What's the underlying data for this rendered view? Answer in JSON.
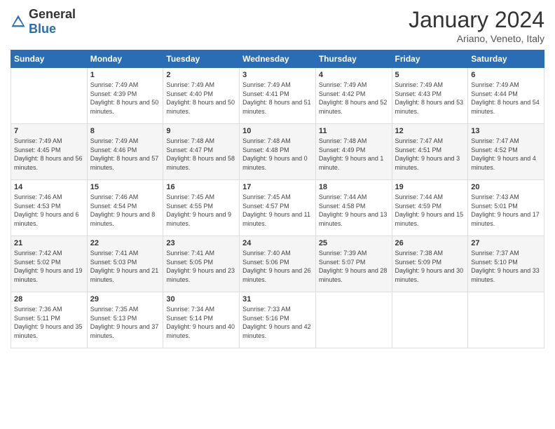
{
  "header": {
    "logo_general": "General",
    "logo_blue": "Blue",
    "month_title": "January 2024",
    "subtitle": "Ariano, Veneto, Italy"
  },
  "weekdays": [
    "Sunday",
    "Monday",
    "Tuesday",
    "Wednesday",
    "Thursday",
    "Friday",
    "Saturday"
  ],
  "weeks": [
    [
      {
        "day": "",
        "sunrise": "",
        "sunset": "",
        "daylight": ""
      },
      {
        "day": "1",
        "sunrise": "Sunrise: 7:49 AM",
        "sunset": "Sunset: 4:39 PM",
        "daylight": "Daylight: 8 hours and 50 minutes."
      },
      {
        "day": "2",
        "sunrise": "Sunrise: 7:49 AM",
        "sunset": "Sunset: 4:40 PM",
        "daylight": "Daylight: 8 hours and 50 minutes."
      },
      {
        "day": "3",
        "sunrise": "Sunrise: 7:49 AM",
        "sunset": "Sunset: 4:41 PM",
        "daylight": "Daylight: 8 hours and 51 minutes."
      },
      {
        "day": "4",
        "sunrise": "Sunrise: 7:49 AM",
        "sunset": "Sunset: 4:42 PM",
        "daylight": "Daylight: 8 hours and 52 minutes."
      },
      {
        "day": "5",
        "sunrise": "Sunrise: 7:49 AM",
        "sunset": "Sunset: 4:43 PM",
        "daylight": "Daylight: 8 hours and 53 minutes."
      },
      {
        "day": "6",
        "sunrise": "Sunrise: 7:49 AM",
        "sunset": "Sunset: 4:44 PM",
        "daylight": "Daylight: 8 hours and 54 minutes."
      }
    ],
    [
      {
        "day": "7",
        "sunrise": "Sunrise: 7:49 AM",
        "sunset": "Sunset: 4:45 PM",
        "daylight": "Daylight: 8 hours and 56 minutes."
      },
      {
        "day": "8",
        "sunrise": "Sunrise: 7:49 AM",
        "sunset": "Sunset: 4:46 PM",
        "daylight": "Daylight: 8 hours and 57 minutes."
      },
      {
        "day": "9",
        "sunrise": "Sunrise: 7:48 AM",
        "sunset": "Sunset: 4:47 PM",
        "daylight": "Daylight: 8 hours and 58 minutes."
      },
      {
        "day": "10",
        "sunrise": "Sunrise: 7:48 AM",
        "sunset": "Sunset: 4:48 PM",
        "daylight": "Daylight: 9 hours and 0 minutes."
      },
      {
        "day": "11",
        "sunrise": "Sunrise: 7:48 AM",
        "sunset": "Sunset: 4:49 PM",
        "daylight": "Daylight: 9 hours and 1 minute."
      },
      {
        "day": "12",
        "sunrise": "Sunrise: 7:47 AM",
        "sunset": "Sunset: 4:51 PM",
        "daylight": "Daylight: 9 hours and 3 minutes."
      },
      {
        "day": "13",
        "sunrise": "Sunrise: 7:47 AM",
        "sunset": "Sunset: 4:52 PM",
        "daylight": "Daylight: 9 hours and 4 minutes."
      }
    ],
    [
      {
        "day": "14",
        "sunrise": "Sunrise: 7:46 AM",
        "sunset": "Sunset: 4:53 PM",
        "daylight": "Daylight: 9 hours and 6 minutes."
      },
      {
        "day": "15",
        "sunrise": "Sunrise: 7:46 AM",
        "sunset": "Sunset: 4:54 PM",
        "daylight": "Daylight: 9 hours and 8 minutes."
      },
      {
        "day": "16",
        "sunrise": "Sunrise: 7:45 AM",
        "sunset": "Sunset: 4:55 PM",
        "daylight": "Daylight: 9 hours and 9 minutes."
      },
      {
        "day": "17",
        "sunrise": "Sunrise: 7:45 AM",
        "sunset": "Sunset: 4:57 PM",
        "daylight": "Daylight: 9 hours and 11 minutes."
      },
      {
        "day": "18",
        "sunrise": "Sunrise: 7:44 AM",
        "sunset": "Sunset: 4:58 PM",
        "daylight": "Daylight: 9 hours and 13 minutes."
      },
      {
        "day": "19",
        "sunrise": "Sunrise: 7:44 AM",
        "sunset": "Sunset: 4:59 PM",
        "daylight": "Daylight: 9 hours and 15 minutes."
      },
      {
        "day": "20",
        "sunrise": "Sunrise: 7:43 AM",
        "sunset": "Sunset: 5:01 PM",
        "daylight": "Daylight: 9 hours and 17 minutes."
      }
    ],
    [
      {
        "day": "21",
        "sunrise": "Sunrise: 7:42 AM",
        "sunset": "Sunset: 5:02 PM",
        "daylight": "Daylight: 9 hours and 19 minutes."
      },
      {
        "day": "22",
        "sunrise": "Sunrise: 7:41 AM",
        "sunset": "Sunset: 5:03 PM",
        "daylight": "Daylight: 9 hours and 21 minutes."
      },
      {
        "day": "23",
        "sunrise": "Sunrise: 7:41 AM",
        "sunset": "Sunset: 5:05 PM",
        "daylight": "Daylight: 9 hours and 23 minutes."
      },
      {
        "day": "24",
        "sunrise": "Sunrise: 7:40 AM",
        "sunset": "Sunset: 5:06 PM",
        "daylight": "Daylight: 9 hours and 26 minutes."
      },
      {
        "day": "25",
        "sunrise": "Sunrise: 7:39 AM",
        "sunset": "Sunset: 5:07 PM",
        "daylight": "Daylight: 9 hours and 28 minutes."
      },
      {
        "day": "26",
        "sunrise": "Sunrise: 7:38 AM",
        "sunset": "Sunset: 5:09 PM",
        "daylight": "Daylight: 9 hours and 30 minutes."
      },
      {
        "day": "27",
        "sunrise": "Sunrise: 7:37 AM",
        "sunset": "Sunset: 5:10 PM",
        "daylight": "Daylight: 9 hours and 33 minutes."
      }
    ],
    [
      {
        "day": "28",
        "sunrise": "Sunrise: 7:36 AM",
        "sunset": "Sunset: 5:11 PM",
        "daylight": "Daylight: 9 hours and 35 minutes."
      },
      {
        "day": "29",
        "sunrise": "Sunrise: 7:35 AM",
        "sunset": "Sunset: 5:13 PM",
        "daylight": "Daylight: 9 hours and 37 minutes."
      },
      {
        "day": "30",
        "sunrise": "Sunrise: 7:34 AM",
        "sunset": "Sunset: 5:14 PM",
        "daylight": "Daylight: 9 hours and 40 minutes."
      },
      {
        "day": "31",
        "sunrise": "Sunrise: 7:33 AM",
        "sunset": "Sunset: 5:16 PM",
        "daylight": "Daylight: 9 hours and 42 minutes."
      },
      {
        "day": "",
        "sunrise": "",
        "sunset": "",
        "daylight": ""
      },
      {
        "day": "",
        "sunrise": "",
        "sunset": "",
        "daylight": ""
      },
      {
        "day": "",
        "sunrise": "",
        "sunset": "",
        "daylight": ""
      }
    ]
  ]
}
